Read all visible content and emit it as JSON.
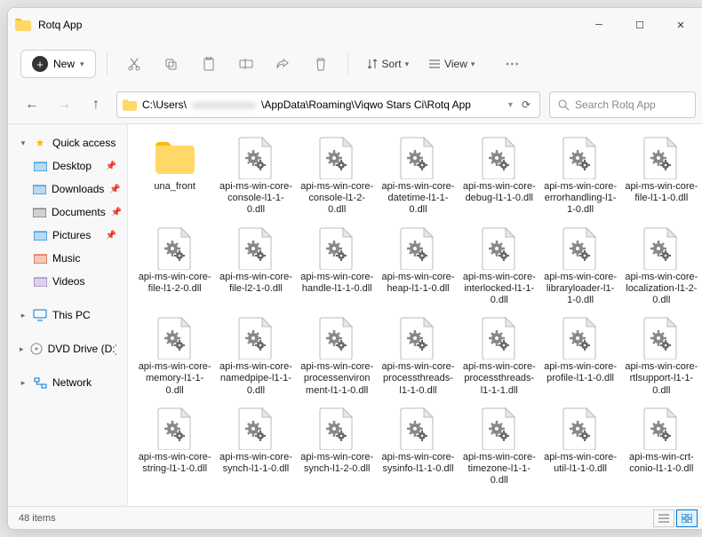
{
  "window": {
    "title": "Rotq App"
  },
  "toolbar": {
    "new_label": "New",
    "sort_label": "Sort",
    "view_label": "View"
  },
  "address": {
    "path_prefix": "C:\\Users\\",
    "path_blurred": "xxxxxxxxxxxx",
    "path_suffix": "\\AppData\\Roaming\\Viqwo Stars Ci\\Rotq App",
    "search_placeholder": "Search Rotq App"
  },
  "sidebar": {
    "quick_access": "Quick access",
    "items": [
      {
        "label": "Desktop",
        "color": "#0078d4",
        "pinned": true
      },
      {
        "label": "Downloads",
        "color": "#0078d4",
        "pinned": true
      },
      {
        "label": "Documents",
        "color": "#5a5a5a",
        "pinned": true
      },
      {
        "label": "Pictures",
        "color": "#0078d4",
        "pinned": true
      },
      {
        "label": "Music",
        "color": "#d83b01",
        "pinned": false
      },
      {
        "label": "Videos",
        "color": "#8764b8",
        "pinned": false
      }
    ],
    "this_pc": "This PC",
    "dvd": "DVD Drive (D:) CCCC",
    "network": "Network"
  },
  "files": {
    "folder": "una_front",
    "dlls": [
      "api-ms-win-core-console-l1-1-0.dll",
      "api-ms-win-core-console-l1-2-0.dll",
      "api-ms-win-core-datetime-l1-1-0.dll",
      "api-ms-win-core-debug-l1-1-0.dll",
      "api-ms-win-core-errorhandling-l1-1-0.dll",
      "api-ms-win-core-file-l1-1-0.dll",
      "api-ms-win-core-file-l1-2-0.dll",
      "api-ms-win-core-file-l2-1-0.dll",
      "api-ms-win-core-handle-l1-1-0.dll",
      "api-ms-win-core-heap-l1-1-0.dll",
      "api-ms-win-core-interlocked-l1-1-0.dll",
      "api-ms-win-core-libraryloader-l1-1-0.dll",
      "api-ms-win-core-localization-l1-2-0.dll",
      "api-ms-win-core-memory-l1-1-0.dll",
      "api-ms-win-core-namedpipe-l1-1-0.dll",
      "api-ms-win-core-processenvironment-l1-1-0.dll",
      "api-ms-win-core-processthreads-l1-1-0.dll",
      "api-ms-win-core-processthreads-l1-1-1.dll",
      "api-ms-win-core-profile-l1-1-0.dll",
      "api-ms-win-core-rtlsupport-l1-1-0.dll",
      "api-ms-win-core-string-l1-1-0.dll",
      "api-ms-win-core-synch-l1-1-0.dll",
      "api-ms-win-core-synch-l1-2-0.dll",
      "api-ms-win-core-sysinfo-l1-1-0.dll",
      "api-ms-win-core-timezone-l1-1-0.dll",
      "api-ms-win-core-util-l1-1-0.dll",
      "api-ms-win-crt-conio-l1-1-0.dll"
    ]
  },
  "status": {
    "count": "48 items"
  }
}
